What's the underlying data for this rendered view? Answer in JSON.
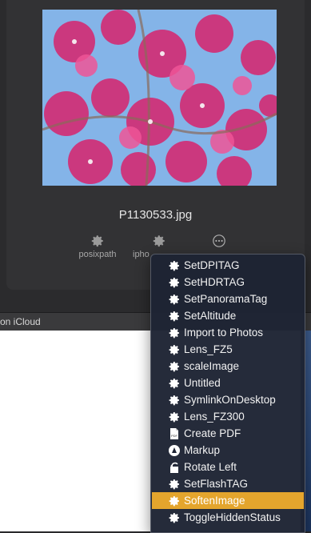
{
  "preview": {
    "filename": "P1130533.jpg"
  },
  "quick_actions": [
    {
      "label": "posixpath",
      "icon": "gear-icon"
    },
    {
      "label": "ipho",
      "icon": "gear-icon"
    },
    {
      "label": "",
      "icon": "more-icon"
    }
  ],
  "icloud_bar": {
    "text": "on iCloud"
  },
  "context_menu": {
    "items": [
      {
        "label": "SetDPITAG",
        "icon": "gear-icon"
      },
      {
        "label": "SetHDRTAG",
        "icon": "gear-icon"
      },
      {
        "label": "SetPanoramaTag",
        "icon": "gear-icon"
      },
      {
        "label": "SetAltitude",
        "icon": "gear-icon"
      },
      {
        "label": "Import to Photos",
        "icon": "gear-icon"
      },
      {
        "label": "Lens_FZ5",
        "icon": "gear-icon"
      },
      {
        "label": "scaleImage",
        "icon": "gear-icon"
      },
      {
        "label": "Untitled",
        "icon": "gear-icon"
      },
      {
        "label": "SymlinkOnDesktop",
        "icon": "gear-icon"
      },
      {
        "label": "Lens_FZ300",
        "icon": "gear-icon"
      },
      {
        "label": "Create PDF",
        "icon": "pdf-document-icon"
      },
      {
        "label": "Markup",
        "icon": "markup-icon"
      },
      {
        "label": "Rotate Left",
        "icon": "rotate-left-icon"
      },
      {
        "label": "SetFlashTAG",
        "icon": "gear-icon"
      },
      {
        "label": "SoftenImage",
        "icon": "gear-icon",
        "highlighted": true
      },
      {
        "label": "ToggleHiddenStatus",
        "icon": "gear-icon"
      }
    ]
  },
  "colors": {
    "menu_highlight": "#e4a52d",
    "photo_sky": "#7fb0e6",
    "flower_pink": "#e0307a"
  }
}
